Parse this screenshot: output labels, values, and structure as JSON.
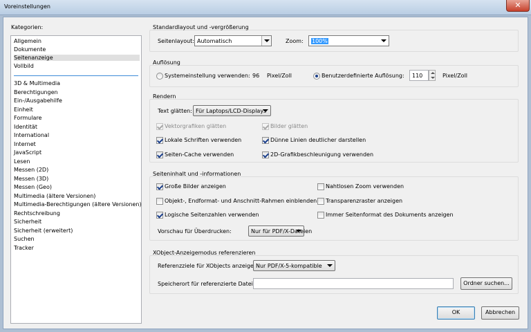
{
  "window": {
    "title": "Voreinstellungen",
    "close_glyph": "✕"
  },
  "categories": {
    "label": "Kategorien:",
    "group1": [
      "Allgemein",
      "Dokumente",
      "Seitenanzeige",
      "Vollbild"
    ],
    "selected": "Seitenanzeige",
    "group2": [
      "3D & Multimedia",
      "Berechtigungen",
      "Ein-/Ausgabehilfe",
      "Einheit",
      "Formulare",
      "Identität",
      "International",
      "Internet",
      "JavaScript",
      "Lesen",
      "Messen (2D)",
      "Messen (3D)",
      "Messen (Geo)",
      "Multimedia (ältere Versionen)",
      "Multimedia-Berechtigungen (ältere Versionen)",
      "Rechtschreibung",
      "Sicherheit",
      "Sicherheit (erweitert)",
      "Suchen",
      "Tracker"
    ]
  },
  "layout": {
    "title": "Standardlayout und -vergrößerung",
    "seitenlayout_label": "Seitenlayout:",
    "seitenlayout_value": "Automatisch",
    "zoom_label": "Zoom:",
    "zoom_value": "100%"
  },
  "resolution": {
    "title": "Auflösung",
    "system_label": "Systemeinstellung verwenden:",
    "system_value": "96",
    "system_unit": "Pixel/Zoll",
    "custom_label": "Benutzerdefinierte Auflösung:",
    "custom_value": "110",
    "custom_unit": "Pixel/Zoll",
    "selected": "custom"
  },
  "rendering": {
    "title": "Rendern",
    "smooth_label": "Text glätten:",
    "smooth_value": "Für Laptops/LCD-Displays",
    "vector_smooth": "Vektorgrafiken glätten",
    "image_smooth": "Bilder glätten",
    "local_fonts": "Lokale Schriften verwenden",
    "thin_lines": "Dünne Linien deutlicher darstellen",
    "page_cache": "Seiten-Cache verwenden",
    "gpu_accel": "2D-Grafikbeschleunigung verwenden",
    "checked": {
      "vector_smooth": true,
      "image_smooth": true,
      "local_fonts": true,
      "thin_lines": true,
      "page_cache": true,
      "gpu_accel": true
    }
  },
  "page_content": {
    "title": "Seiteninhalt und -informationen",
    "large_images": "Große Bilder anzeigen",
    "smooth_zoom": "Nahtlosen Zoom verwenden",
    "object_boxes": "Objekt-, Endformat- und Anschnitt-Rahmen einblenden",
    "transparency_grid": "Transparenzraster anzeigen",
    "logical_pages": "Logische Seitenzahlen verwenden",
    "always_page_format": "Immer Seitenformat des Dokuments anzeigen",
    "overprint_label": "Vorschau für Überdrucken:",
    "overprint_value": "Nur für PDF/X-Dateien",
    "checked": {
      "large_images": true,
      "smooth_zoom": false,
      "object_boxes": false,
      "transparency_grid": false,
      "logical_pages": true,
      "always_page_format": false
    }
  },
  "xobject": {
    "title": "XObject-Anzeigemodus referenzieren",
    "targets_label": "Referenzziele für XObjects anzeigen:",
    "targets_value": "Nur PDF/X-5-kompatible",
    "location_label": "Speicherort für referenzierte Dateien:",
    "location_value": "",
    "browse_button": "Ordner suchen..."
  },
  "buttons": {
    "ok": "OK",
    "cancel": "Abbrechen"
  }
}
